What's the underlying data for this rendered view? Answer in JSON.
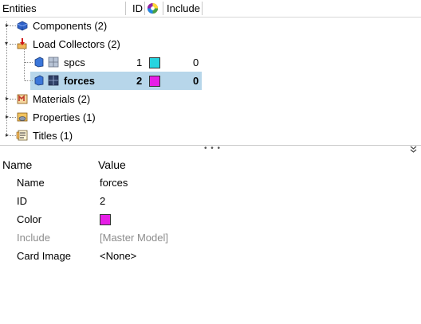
{
  "header": {
    "entities": "Entities",
    "id": "ID",
    "include": "Include",
    "color_icon": "color-wheel-icon"
  },
  "tree": [
    {
      "label": "Components (2)",
      "icon": "components-icon",
      "expanded": false
    },
    {
      "label": "Load Collectors (2)",
      "icon": "load-collectors-icon",
      "expanded": true,
      "children": [
        {
          "label": "spcs",
          "id": "1",
          "color": "#26d4e0",
          "include": "0",
          "selected": false
        },
        {
          "label": "forces",
          "id": "2",
          "color": "#e61ee6",
          "include": "0",
          "selected": true
        }
      ]
    },
    {
      "label": "Materials (2)",
      "icon": "materials-icon",
      "expanded": false
    },
    {
      "label": "Properties (1)",
      "icon": "properties-icon",
      "expanded": false
    },
    {
      "label": "Titles (1)",
      "icon": "titles-icon",
      "expanded": false
    }
  ],
  "splitter": {
    "grip": "• • •",
    "collapse_icon": "double-chevron-down-icon"
  },
  "properties": {
    "name_header": "Name",
    "value_header": "Value",
    "rows": [
      {
        "label": "Name",
        "value": "forces"
      },
      {
        "label": "ID",
        "value": "2"
      },
      {
        "label": "Color",
        "value": "",
        "color": "#e61ee6"
      },
      {
        "label": "Include",
        "value": "[Master Model]",
        "disabled": true
      },
      {
        "label": "Card Image",
        "value": "<None>"
      }
    ]
  }
}
